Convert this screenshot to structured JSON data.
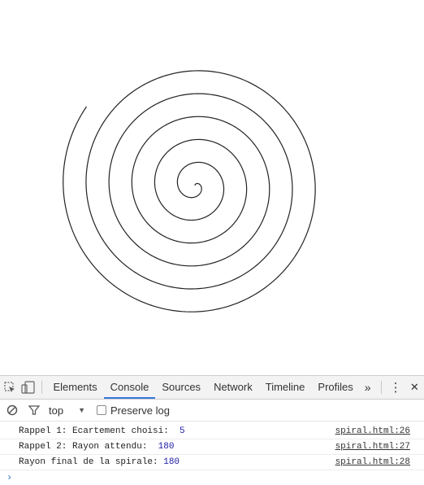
{
  "devtools": {
    "tabs": [
      "Elements",
      "Console",
      "Sources",
      "Network",
      "Timeline",
      "Profiles"
    ],
    "active_tab": "Console",
    "more_tabs_glyph": "»",
    "menu_glyph": "⋮",
    "close_glyph": "✕",
    "filter": {
      "context": "top",
      "context_arrow": "▼",
      "preserve_log_label": "Preserve log"
    },
    "console": [
      {
        "text": "Rappel 1: Ecartement choisi:  ",
        "value": "5",
        "source": "spiral.html:26"
      },
      {
        "text": "Rappel 2: Rayon attendu:  ",
        "value": "180",
        "source": "spiral.html:27"
      },
      {
        "text": "Rayon final de la spirale: ",
        "value": "180",
        "source": "spiral.html:28"
      }
    ],
    "prompt_glyph": "›"
  },
  "spiral": {
    "stroke": "#222222",
    "background": "#ffffff",
    "turns": 5.85
  }
}
